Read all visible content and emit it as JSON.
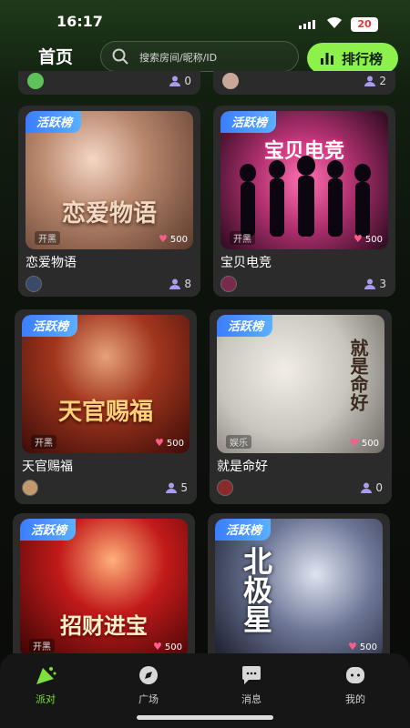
{
  "status": {
    "time": "16:17",
    "battery": "20"
  },
  "header": {
    "title": "首页",
    "search_placeholder": "搜索房间/昵称/ID",
    "rank_label": "排行榜"
  },
  "top_partial": [
    {
      "count": "0"
    },
    {
      "count": "2"
    }
  ],
  "rooms": [
    {
      "badge": "活跃榜",
      "name": "恋爱物语",
      "cover_title": "恋爱物语",
      "tag": "开黑",
      "heat": "500",
      "count": "8",
      "theme": "#7a5848"
    },
    {
      "badge": "活跃榜",
      "name": "宝贝电竞",
      "cover_title": "宝贝电竞",
      "tag": "开黑",
      "heat": "500",
      "count": "3",
      "theme": "#b0306f"
    },
    {
      "badge": "活跃榜",
      "name": "天官赐福",
      "cover_title": "天官赐福",
      "tag": "开黑",
      "heat": "500",
      "count": "5",
      "theme": "#7a1a14"
    },
    {
      "badge": "活跃榜",
      "name": "就是命好",
      "cover_title": "就是命好",
      "tag": "娱乐",
      "heat": "500",
      "count": "0",
      "theme": "#c9c6be"
    },
    {
      "badge": "活跃榜",
      "name": "",
      "cover_title": "招财进宝",
      "tag": "开黑",
      "heat": "500",
      "count": "",
      "theme": "#8a0d10"
    },
    {
      "badge": "活跃榜",
      "name": "",
      "cover_title": "北极星",
      "tag": "",
      "heat": "500",
      "count": "",
      "theme": "#2b3046"
    }
  ],
  "tabs": [
    {
      "label": "派对",
      "icon": "party-icon",
      "active": true
    },
    {
      "label": "广场",
      "icon": "compass-icon",
      "active": false
    },
    {
      "label": "消息",
      "icon": "message-icon",
      "active": false
    },
    {
      "label": "我的",
      "icon": "profile-icon",
      "active": false
    }
  ],
  "colors": {
    "accent": "#8ef04a",
    "badge_blue": "#3b7dff",
    "heat_pink": "#ff5b8a"
  }
}
